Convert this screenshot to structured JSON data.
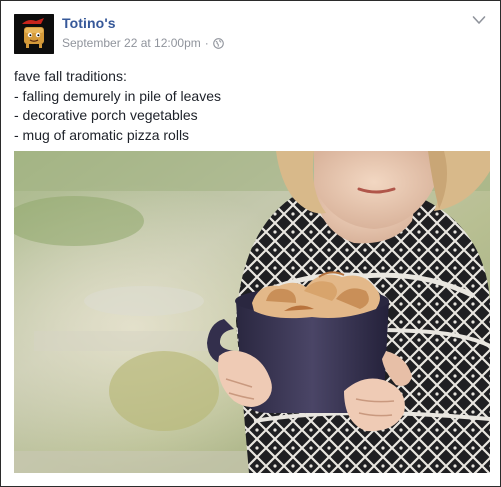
{
  "post": {
    "author": "Totino's",
    "timestamp": "September 22 at 12:00pm",
    "separator": "·",
    "privacy_icon": "globe-icon",
    "menu_icon": "chevron-down-icon",
    "text_lines": [
      "fave fall traditions:",
      "- falling demurely in pile of leaves",
      "- decorative porch vegetables",
      "- mug of aromatic pizza rolls"
    ]
  },
  "colors": {
    "author_link": "#365899",
    "meta_gray": "#90949c",
    "body_text": "#1d2129",
    "mug": "#3a3656",
    "sweater_dark": "#1f1f22",
    "hair": "#d8b98a"
  }
}
